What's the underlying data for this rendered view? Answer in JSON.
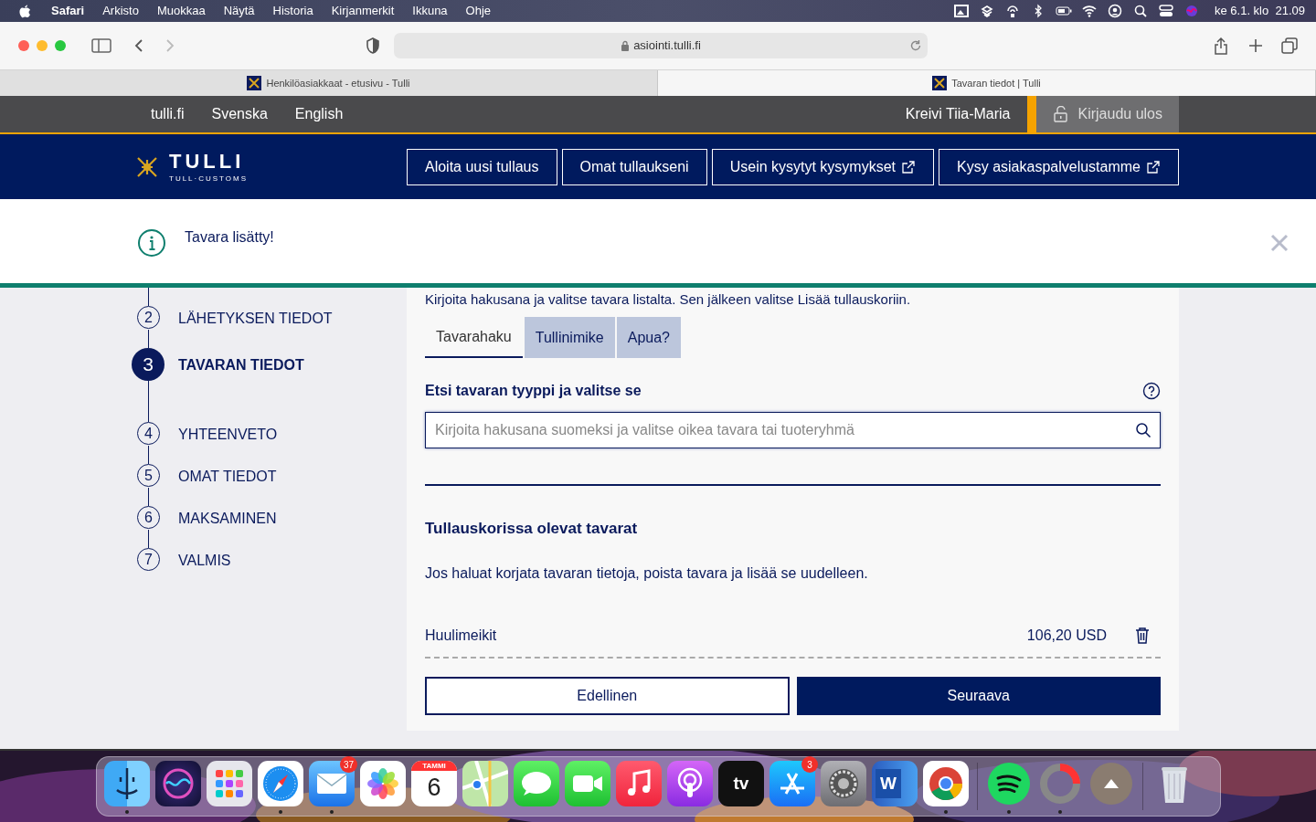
{
  "menu_bar": {
    "app": "Safari",
    "items": [
      "Arkisto",
      "Muokkaa",
      "Näytä",
      "Historia",
      "Kirjanmerkit",
      "Ikkuna",
      "Ohje"
    ],
    "clock": "ke 6.1. klo  21.09"
  },
  "browser": {
    "url": "asiointi.tulli.fi",
    "tabs": [
      {
        "title": "Henkilöasiakkaat - etusivu - Tulli",
        "selected": false
      },
      {
        "title": "Tavaran tiedot | Tulli",
        "selected": true
      }
    ]
  },
  "top_bar": {
    "links": [
      "tulli.fi",
      "Svenska",
      "English"
    ],
    "user": "Kreivi Tiia-Maria",
    "logout": "Kirjaudu ulos"
  },
  "header": {
    "logo_title": "TULLI",
    "logo_subtitle": "TULL·CUSTOMS",
    "buttons": [
      {
        "label": "Aloita uusi tullaus",
        "external": false
      },
      {
        "label": "Omat tullaukseni",
        "external": false
      },
      {
        "label": "Usein kysytyt kysymykset",
        "external": true
      },
      {
        "label": "Kysy asiakaspalvelustamme",
        "external": true
      }
    ]
  },
  "notification": {
    "message": "Tavara lisätty!"
  },
  "steps": [
    {
      "number": "2",
      "label": "LÄHETYKSEN TIEDOT",
      "selected": false
    },
    {
      "number": "3",
      "label": "TAVARAN TIEDOT",
      "selected": true
    },
    {
      "number": "4",
      "label": "YHTEENVETO",
      "selected": false
    },
    {
      "number": "5",
      "label": "OMAT TIEDOT",
      "selected": false
    },
    {
      "number": "6",
      "label": "MAKSAMINEN",
      "selected": false
    },
    {
      "number": "7",
      "label": "VALMIS",
      "selected": false
    }
  ],
  "instructions": "Kirjoita hakusana ja valitse tavara listalta. Sen jälkeen valitse Lisää tullauskoriin.",
  "search_tabs": [
    {
      "label": "Tavarahaku",
      "selected": true
    },
    {
      "label": "Tullinimike",
      "selected": false
    },
    {
      "label": "Apua?",
      "selected": false
    }
  ],
  "search": {
    "label": "Etsi tavaran tyyppi ja valitse se",
    "placeholder": "Kirjoita hakusana suomeksi ja valitse oikea tavara tai tuoteryhmä"
  },
  "basket": {
    "title": "Tullauskorissa olevat tavarat",
    "hint": "Jos haluat korjata tavaran tietoja, poista tavara ja lisää se uudelleen.",
    "items": [
      {
        "name": "Huulimeikit",
        "price": "106,20 USD"
      }
    ]
  },
  "nav_buttons": {
    "previous": "Edellinen",
    "next": "Seuraava"
  },
  "dock": {
    "apps": [
      {
        "kind": "finder",
        "running": true
      },
      {
        "kind": "siri",
        "running": false
      },
      {
        "kind": "launchpad",
        "running": false
      },
      {
        "kind": "safari",
        "running": true
      },
      {
        "kind": "mail",
        "running": true,
        "badge": "37"
      },
      {
        "kind": "photos",
        "running": false
      },
      {
        "kind": "calendar",
        "running": false,
        "month": "TAMMI",
        "day": "6"
      },
      {
        "kind": "maps",
        "running": false
      },
      {
        "kind": "messages",
        "running": false
      },
      {
        "kind": "facetime",
        "running": false
      },
      {
        "kind": "music",
        "running": false
      },
      {
        "kind": "podcasts",
        "running": false
      },
      {
        "kind": "tv",
        "running": false,
        "text": "tv"
      },
      {
        "kind": "appstore",
        "running": false,
        "badge": "3"
      },
      {
        "kind": "settings",
        "running": false
      },
      {
        "kind": "word",
        "running": false,
        "text": "W"
      },
      {
        "kind": "chrome",
        "running": true
      },
      {
        "kind": "separator"
      },
      {
        "kind": "spotify",
        "running": true
      },
      {
        "kind": "ring",
        "running": true
      },
      {
        "kind": "mountain",
        "running": false
      },
      {
        "kind": "separator"
      },
      {
        "kind": "trash",
        "running": false
      }
    ]
  }
}
